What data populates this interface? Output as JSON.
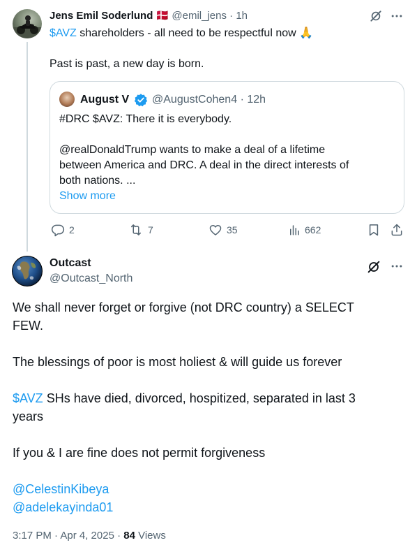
{
  "reply": {
    "author_name": "Jens Emil Soderlund",
    "flag": "🇩🇰",
    "handle": "@emil_jens",
    "separator": "·",
    "time": "1h",
    "text_cashtag": "$AVZ",
    "text_line1_rest": " shareholders - all need to be respectful now ",
    "text_emoji": "🙏",
    "text_line2": "Past is past, a new day is born.",
    "quote": {
      "author_name": "August V",
      "handle": "@AugustCohen4",
      "separator": "·",
      "time": "12h",
      "line1": "#DRC $AVZ:  There it is everybody.",
      "line2": "@realDonaldTrump wants to make a deal of a lifetime",
      "line3": "between America and DRC. A deal in the direct interests of",
      "line4": "both nations.  ...",
      "show_more": "Show more"
    },
    "actions": {
      "replies": "2",
      "reposts": "7",
      "likes": "35",
      "views": "662"
    }
  },
  "main": {
    "author_name": "Outcast",
    "handle": "@Outcast_North",
    "para1_line1": "We shall never forget or forgive (not DRC country) a SELECT",
    "para1_line2": "FEW.",
    "para2": "The blessings of poor is most holiest & will guide us forever",
    "para3_cashtag": "$AVZ",
    "para3_line1_rest": " SHs have died, divorced, hospitized, separated in last 3",
    "para3_line2": "years",
    "para4": "If you & I are fine does not permit forgiveness",
    "mention1": "@CelestinKibeya",
    "mention2": "@adelekayinda01",
    "timestamp": "3:17 PM · Apr 4, 2025 · ",
    "views_count": "84",
    "views_label": " Views"
  },
  "colors": {
    "link": "#1d9bf0",
    "secondary_text": "#536471",
    "border": "#cfd9de",
    "verified": "#1d9bf0"
  },
  "icons": [
    "grok-icon",
    "more-icon",
    "reply-icon",
    "repost-icon",
    "like-icon",
    "views-icon",
    "bookmark-icon",
    "share-icon",
    "verified-badge-icon"
  ]
}
